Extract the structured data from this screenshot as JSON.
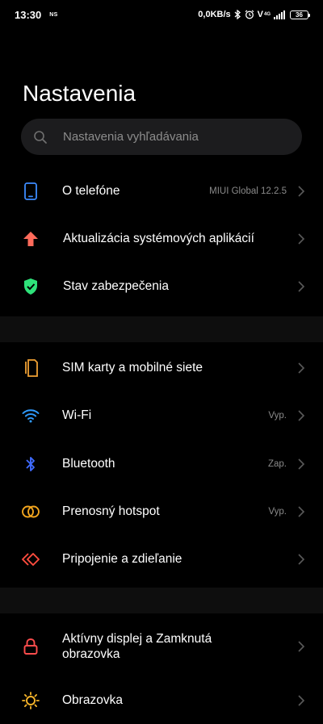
{
  "status_bar": {
    "time": "13:30",
    "carrier": "NS",
    "net_speed": "0,0KB/s",
    "volte": "V",
    "signal_label": "4G",
    "battery": "36"
  },
  "page_title": "Nastavenia",
  "search": {
    "placeholder": "Nastavenia vyhľadávania"
  },
  "sections": [
    {
      "items": [
        {
          "label": "O telefóne",
          "value": "MIUI Global 12.2.5",
          "icon": "phone-icon"
        },
        {
          "label": "Aktualizácia systémových aplikácií",
          "value": "",
          "icon": "arrow-up-icon"
        },
        {
          "label": "Stav zabezpečenia",
          "value": "",
          "icon": "shield-check-icon"
        }
      ]
    },
    {
      "items": [
        {
          "label": "SIM karty a mobilné siete",
          "value": "",
          "icon": "sim-card-icon"
        },
        {
          "label": "Wi-Fi",
          "value": "Vyp.",
          "icon": "wifi-icon"
        },
        {
          "label": "Bluetooth",
          "value": "Zap.",
          "icon": "bluetooth-icon"
        },
        {
          "label": "Prenosný hotspot",
          "value": "Vyp.",
          "icon": "hotspot-icon"
        },
        {
          "label": "Pripojenie a zdieľanie",
          "value": "",
          "icon": "connection-sharing-icon"
        }
      ]
    },
    {
      "items": [
        {
          "label": "Aktívny displej a Zamknutá obrazovka",
          "value": "",
          "icon": "lock-icon"
        },
        {
          "label": "Obrazovka",
          "value": "",
          "icon": "brightness-icon"
        }
      ]
    }
  ],
  "colors": {
    "background": "#000000",
    "section_gap": "#0e0e0e",
    "search_bg": "#1c1c1e",
    "phone": "#3d8cff",
    "update": "#ff6b5b",
    "shield": "#2ee27a",
    "sim": "#f0a033",
    "wifi": "#2f9bff",
    "bluetooth": "#3f6bff",
    "hotspot": "#f2a51e",
    "sharing": "#ff4d3f",
    "lock": "#ff4d4d",
    "brightness": "#f7b52a"
  }
}
